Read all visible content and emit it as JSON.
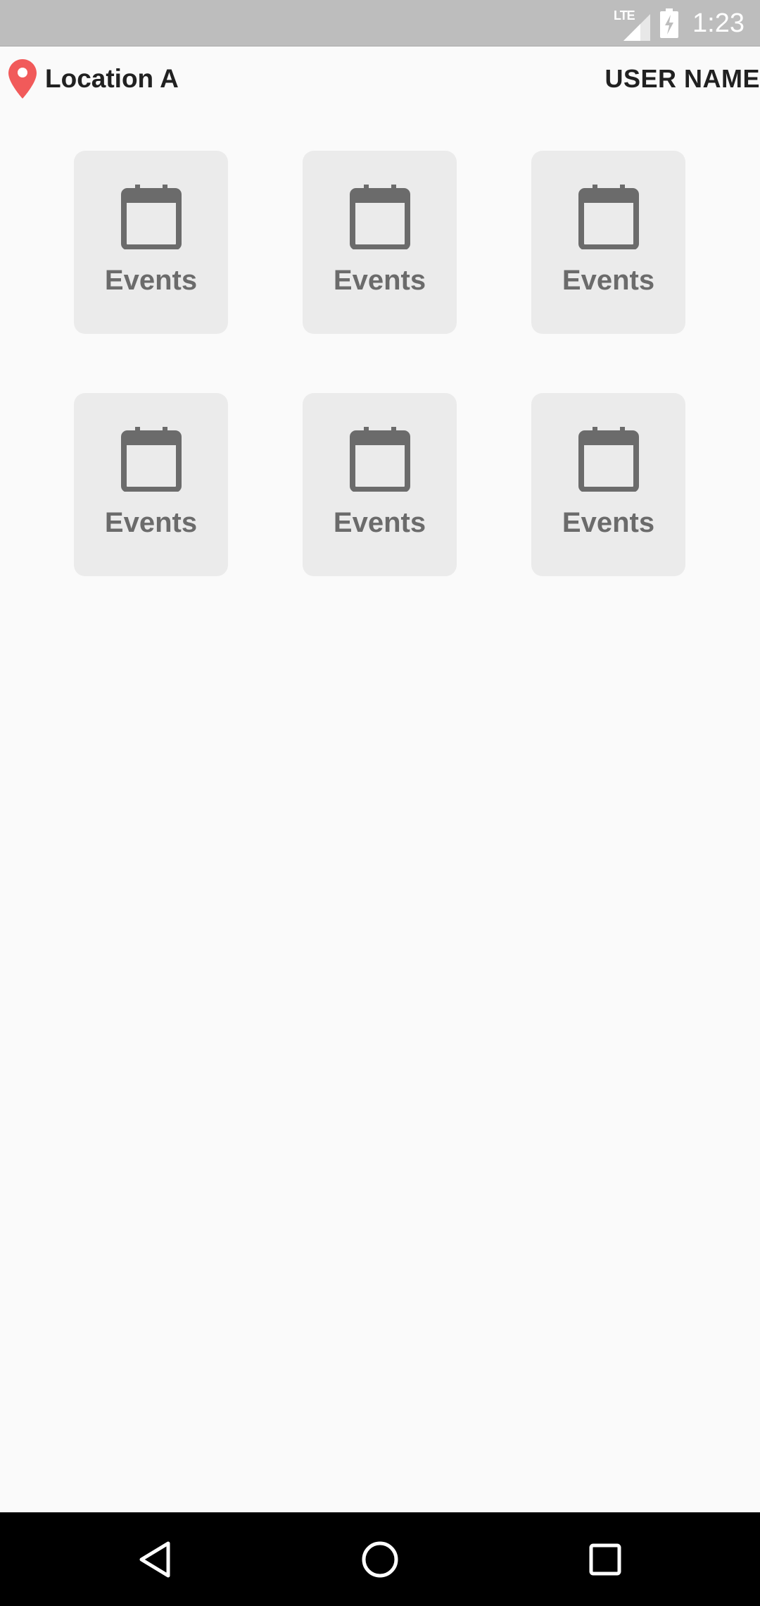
{
  "status_bar": {
    "network_label": "LTE",
    "time": "1:23",
    "signal_icon": "signal-icon",
    "battery_icon": "battery-charging-icon"
  },
  "header": {
    "location_icon": "location-pin-icon",
    "location_name": "Location A",
    "user_name": "USER NAME"
  },
  "tiles": [
    {
      "icon": "calendar-icon",
      "label": "Events"
    },
    {
      "icon": "calendar-icon",
      "label": "Events"
    },
    {
      "icon": "calendar-icon",
      "label": "Events"
    },
    {
      "icon": "calendar-icon",
      "label": "Events"
    },
    {
      "icon": "calendar-icon",
      "label": "Events"
    },
    {
      "icon": "calendar-icon",
      "label": "Events"
    }
  ],
  "nav_bar": {
    "back_icon": "back-icon",
    "home_icon": "home-icon",
    "recents_icon": "recents-icon"
  },
  "colors": {
    "status_bar_bg": "#bdbdbd",
    "page_bg": "#fafafa",
    "tile_bg": "#ebebeb",
    "tile_fg": "#6b6b6b",
    "location_pin": "#f15a5a",
    "nav_bar_bg": "#000000"
  }
}
